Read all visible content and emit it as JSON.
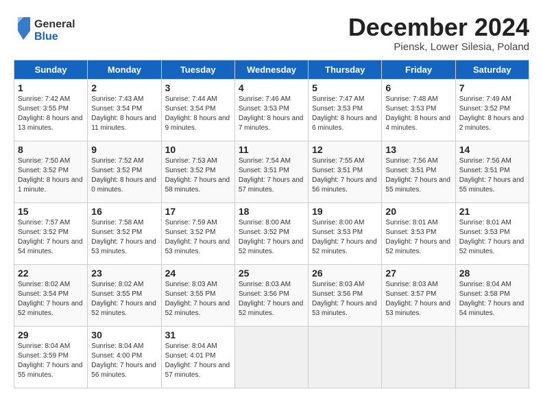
{
  "header": {
    "logo_general": "General",
    "logo_blue": "Blue",
    "month_title": "December 2024",
    "location": "Piensk, Lower Silesia, Poland"
  },
  "weekdays": [
    "Sunday",
    "Monday",
    "Tuesday",
    "Wednesday",
    "Thursday",
    "Friday",
    "Saturday"
  ],
  "weeks": [
    [
      {
        "day": "1",
        "sunrise": "7:42 AM",
        "sunset": "3:55 PM",
        "daylight": "8 hours and 13 minutes."
      },
      {
        "day": "2",
        "sunrise": "7:43 AM",
        "sunset": "3:54 PM",
        "daylight": "8 hours and 11 minutes."
      },
      {
        "day": "3",
        "sunrise": "7:44 AM",
        "sunset": "3:54 PM",
        "daylight": "8 hours and 9 minutes."
      },
      {
        "day": "4",
        "sunrise": "7:46 AM",
        "sunset": "3:53 PM",
        "daylight": "8 hours and 7 minutes."
      },
      {
        "day": "5",
        "sunrise": "7:47 AM",
        "sunset": "3:53 PM",
        "daylight": "8 hours and 6 minutes."
      },
      {
        "day": "6",
        "sunrise": "7:48 AM",
        "sunset": "3:53 PM",
        "daylight": "8 hours and 4 minutes."
      },
      {
        "day": "7",
        "sunrise": "7:49 AM",
        "sunset": "3:52 PM",
        "daylight": "8 hours and 2 minutes."
      }
    ],
    [
      {
        "day": "8",
        "sunrise": "7:50 AM",
        "sunset": "3:52 PM",
        "daylight": "8 hours and 1 minute."
      },
      {
        "day": "9",
        "sunrise": "7:52 AM",
        "sunset": "3:52 PM",
        "daylight": "8 hours and 0 minutes."
      },
      {
        "day": "10",
        "sunrise": "7:53 AM",
        "sunset": "3:52 PM",
        "daylight": "7 hours and 58 minutes."
      },
      {
        "day": "11",
        "sunrise": "7:54 AM",
        "sunset": "3:51 PM",
        "daylight": "7 hours and 57 minutes."
      },
      {
        "day": "12",
        "sunrise": "7:55 AM",
        "sunset": "3:51 PM",
        "daylight": "7 hours and 56 minutes."
      },
      {
        "day": "13",
        "sunrise": "7:56 AM",
        "sunset": "3:51 PM",
        "daylight": "7 hours and 55 minutes."
      },
      {
        "day": "14",
        "sunrise": "7:56 AM",
        "sunset": "3:51 PM",
        "daylight": "7 hours and 55 minutes."
      }
    ],
    [
      {
        "day": "15",
        "sunrise": "7:57 AM",
        "sunset": "3:52 PM",
        "daylight": "7 hours and 54 minutes."
      },
      {
        "day": "16",
        "sunrise": "7:58 AM",
        "sunset": "3:52 PM",
        "daylight": "7 hours and 53 minutes."
      },
      {
        "day": "17",
        "sunrise": "7:59 AM",
        "sunset": "3:52 PM",
        "daylight": "7 hours and 53 minutes."
      },
      {
        "day": "18",
        "sunrise": "8:00 AM",
        "sunset": "3:52 PM",
        "daylight": "7 hours and 52 minutes."
      },
      {
        "day": "19",
        "sunrise": "8:00 AM",
        "sunset": "3:53 PM",
        "daylight": "7 hours and 52 minutes."
      },
      {
        "day": "20",
        "sunrise": "8:01 AM",
        "sunset": "3:53 PM",
        "daylight": "7 hours and 52 minutes."
      },
      {
        "day": "21",
        "sunrise": "8:01 AM",
        "sunset": "3:53 PM",
        "daylight": "7 hours and 52 minutes."
      }
    ],
    [
      {
        "day": "22",
        "sunrise": "8:02 AM",
        "sunset": "3:54 PM",
        "daylight": "7 hours and 52 minutes."
      },
      {
        "day": "23",
        "sunrise": "8:02 AM",
        "sunset": "3:55 PM",
        "daylight": "7 hours and 52 minutes."
      },
      {
        "day": "24",
        "sunrise": "8:03 AM",
        "sunset": "3:55 PM",
        "daylight": "7 hours and 52 minutes."
      },
      {
        "day": "25",
        "sunrise": "8:03 AM",
        "sunset": "3:56 PM",
        "daylight": "7 hours and 52 minutes."
      },
      {
        "day": "26",
        "sunrise": "8:03 AM",
        "sunset": "3:56 PM",
        "daylight": "7 hours and 53 minutes."
      },
      {
        "day": "27",
        "sunrise": "8:03 AM",
        "sunset": "3:57 PM",
        "daylight": "7 hours and 53 minutes."
      },
      {
        "day": "28",
        "sunrise": "8:04 AM",
        "sunset": "3:58 PM",
        "daylight": "7 hours and 54 minutes."
      }
    ],
    [
      {
        "day": "29",
        "sunrise": "8:04 AM",
        "sunset": "3:59 PM",
        "daylight": "7 hours and 55 minutes."
      },
      {
        "day": "30",
        "sunrise": "8:04 AM",
        "sunset": "4:00 PM",
        "daylight": "7 hours and 56 minutes."
      },
      {
        "day": "31",
        "sunrise": "8:04 AM",
        "sunset": "4:01 PM",
        "daylight": "7 hours and 57 minutes."
      },
      null,
      null,
      null,
      null
    ]
  ]
}
